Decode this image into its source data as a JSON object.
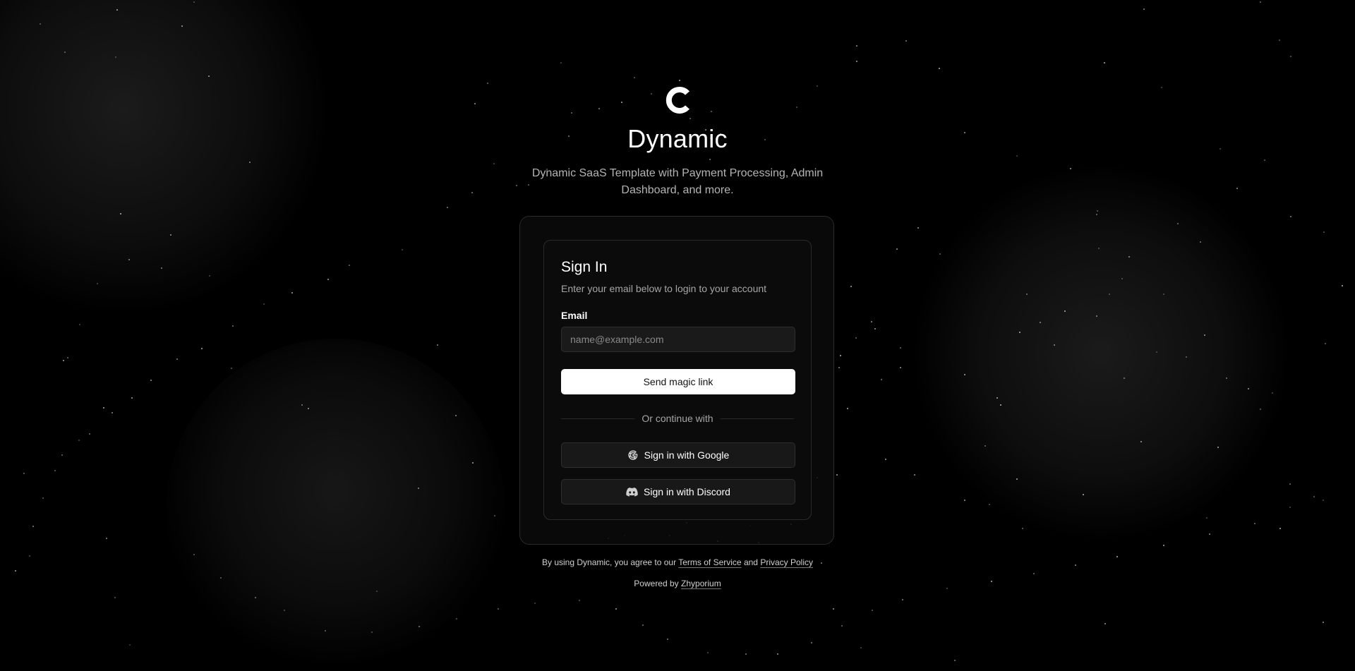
{
  "brand": {
    "logo_icon": "c-logo-icon",
    "name": "Dynamic",
    "tagline": "Dynamic SaaS Template with Payment Processing, Admin Dashboard, and more."
  },
  "sign_in": {
    "title": "Sign In",
    "description": "Enter your email below to login to your account",
    "email_label": "Email",
    "email_placeholder": "name@example.com",
    "email_value": "",
    "submit_label": "Send magic link",
    "divider_text": "Or continue with",
    "google_label": "Sign in with Google",
    "google_icon": "google-icon",
    "discord_label": "Sign in with Discord",
    "discord_icon": "discord-icon"
  },
  "footer": {
    "agree_prefix": "By using Dynamic, you agree to our",
    "terms_label": "Terms of Service",
    "and_text": "and",
    "privacy_label": "Privacy Policy",
    "powered_prefix": "Powered by",
    "powered_link": "Zhyporium"
  },
  "colors": {
    "background": "#000000",
    "card_border": "#2a2a2a",
    "primary_button": "#ffffff",
    "muted_text": "#a6a6a6"
  }
}
